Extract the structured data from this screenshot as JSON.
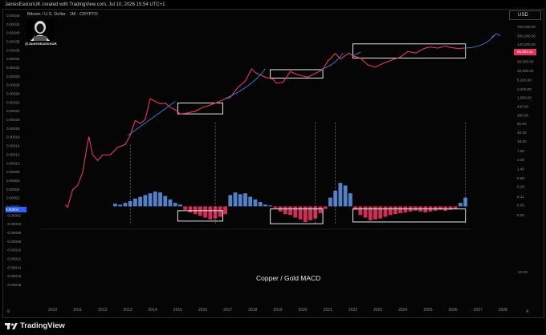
{
  "header": {
    "attribution": "JamesEastonUK created with TradingView.com, Jul 10, 2026 15:54 UTC+1",
    "symbol": "Bitcoin / U.S. Dollar · 1M · CRYPTO",
    "handle": "@JamesEastonUK",
    "currency_button": "USD"
  },
  "chart_data": {
    "type": "line",
    "caption": "Copper / Gold MACD",
    "x_axis": {
      "ticks": [
        "2010",
        "2011",
        "2012",
        "2013",
        "2014",
        "2015",
        "2016",
        "2017",
        "2018",
        "2019",
        "2020",
        "2021",
        "2022",
        "2023",
        "2024",
        "2025",
        "2026",
        "2027",
        "2028"
      ],
      "range": [
        2009.5,
        2028.5
      ]
    },
    "left_axis": {
      "ticks": [
        "0.00044",
        "0.00042",
        "0.00040",
        "0.00038",
        "0.00036",
        "0.00034",
        "0.00032",
        "0.00030",
        "0.00028",
        "0.00026",
        "0.00024",
        "0.00022",
        "0.00020",
        "0.00018",
        "0.00016",
        "0.00014",
        "0.00012",
        "0.00010",
        "0.00008",
        "0.00006",
        "0.00004",
        "0.00002",
        "0.00000",
        "-0.00002",
        "-0.00004",
        "-0.00006",
        "-0.00008",
        "-0.00010",
        "-0.00012",
        "-0.00014",
        "-0.00016",
        "-0.00018"
      ],
      "current_value_label": "0.00004",
      "range": [
        -0.00018,
        0.00044
      ]
    },
    "right_axis": {
      "ticks": [
        "700,000.00",
        "300,000.00",
        "140,000.00",
        "60,000.00",
        "28,000.00",
        "12,000.00",
        "5,200.00",
        "2,200.00",
        "1,000.00",
        "440.00",
        "200.00",
        "90.00",
        "40.00",
        "18.00",
        "7.50",
        "3.30",
        "1.40",
        "0.60",
        "0.28",
        "0.11",
        "0.05",
        "0.02",
        "-10.00"
      ],
      "current_price_label": "95,563.41",
      "scale": "log"
    },
    "series": [
      {
        "name": "Bitcoin / U.S. Dollar",
        "color": "#e8335f",
        "scale": "log",
        "x": [
          2010.5,
          2010.6,
          2010.7,
          2010.8,
          2010.9,
          2011.0,
          2011.2,
          2011.35,
          2011.45,
          2011.6,
          2011.8,
          2012.0,
          2012.3,
          2012.6,
          2012.9,
          2013.1,
          2013.3,
          2013.5,
          2013.7,
          2013.9,
          2014.1,
          2014.3,
          2014.5,
          2014.7,
          2014.9,
          2015.1,
          2015.4,
          2015.7,
          2016.0,
          2016.3,
          2016.6,
          2016.9,
          2017.1,
          2017.4,
          2017.7,
          2017.95,
          2018.1,
          2018.3,
          2018.5,
          2018.8,
          2018.95,
          2019.2,
          2019.5,
          2019.75,
          2020.0,
          2020.2,
          2020.5,
          2020.8,
          2021.0,
          2021.3,
          2021.5,
          2021.85,
          2022.0,
          2022.3,
          2022.6,
          2022.9,
          2023.2,
          2023.5,
          2023.9,
          2024.2,
          2024.5,
          2024.9,
          2025.1,
          2025.4,
          2025.7,
          2025.9,
          2026.2,
          2026.5
        ],
        "values": [
          0.05,
          0.04,
          0.09,
          0.2,
          0.25,
          0.3,
          1.0,
          8,
          27,
          5,
          3,
          5,
          5,
          10,
          13,
          30,
          120,
          90,
          130,
          900,
          700,
          550,
          600,
          400,
          320,
          220,
          240,
          280,
          400,
          500,
          650,
          900,
          1000,
          2500,
          4500,
          14000,
          10000,
          8000,
          6500,
          5500,
          3700,
          4000,
          11000,
          8500,
          7200,
          6500,
          9300,
          13000,
          29000,
          58000,
          35000,
          60000,
          46000,
          38000,
          20000,
          16500,
          23000,
          30000,
          42000,
          70000,
          60000,
          96000,
          105000,
          95000,
          115000,
          100000,
          92000,
          95563
        ]
      },
      {
        "name": "Copper / Gold MACD",
        "type": "histogram",
        "x": [
          2012.5,
          2012.7,
          2012.9,
          2013.1,
          2013.3,
          2013.5,
          2013.7,
          2013.9,
          2014.1,
          2014.3,
          2014.5,
          2014.7,
          2014.9,
          2015.1,
          2015.3,
          2015.5,
          2015.7,
          2015.9,
          2016.1,
          2016.3,
          2016.5,
          2016.7,
          2016.9,
          2017.1,
          2017.3,
          2017.5,
          2017.7,
          2017.9,
          2018.1,
          2018.3,
          2018.5,
          2018.7,
          2018.9,
          2019.1,
          2019.3,
          2019.5,
          2019.7,
          2019.9,
          2020.1,
          2020.3,
          2020.5,
          2020.7,
          2020.9,
          2021.1,
          2021.3,
          2021.5,
          2021.7,
          2021.9,
          2022.1,
          2022.3,
          2022.5,
          2022.7,
          2022.9,
          2023.1,
          2023.3,
          2023.5,
          2023.7,
          2023.9,
          2024.1,
          2024.3,
          2024.5,
          2024.7,
          2024.9,
          2025.1,
          2025.3,
          2025.5,
          2025.7,
          2025.9,
          2026.1,
          2026.3,
          2026.5
        ],
        "values": [
          6e-06,
          4e-06,
          8e-06,
          1.2e-05,
          1.8e-05,
          2.2e-05,
          2.6e-05,
          3e-05,
          3.4e-05,
          3.2e-05,
          2.4e-05,
          1.6e-05,
          8e-06,
          4e-06,
          -8e-06,
          -1.4e-05,
          -1.8e-05,
          -2.2e-05,
          -2.6e-05,
          -3e-05,
          -2.8e-05,
          -2.4e-05,
          -1.8e-05,
          2.6e-05,
          3.2e-05,
          2.8e-05,
          3e-05,
          2.2e-05,
          1.6e-05,
          1e-05,
          4e-06,
          2e-06,
          -4e-06,
          -1.2e-05,
          -1.8e-05,
          -2e-05,
          -2.6e-05,
          -3e-05,
          -3.6e-05,
          -3.2e-05,
          -2.8e-05,
          -1.6e-05,
          -6e-06,
          2e-05,
          3.6e-05,
          5.4e-05,
          4.8e-05,
          3e-05,
          -8e-06,
          -2e-05,
          -2.6e-05,
          -3.2e-05,
          -3e-05,
          -2.8e-05,
          -2.4e-05,
          -2e-05,
          -1.8e-05,
          -1.6e-05,
          -1.4e-05,
          -1.2e-05,
          -1e-05,
          -1.2e-05,
          -1.4e-05,
          -1.2e-05,
          -1e-05,
          -8e-06,
          -1e-05,
          -8e-06,
          -6e-06,
          8e-06,
          2e-05
        ]
      }
    ],
    "colors": {
      "price_line": "#e8335f",
      "macd_positive": "#5b8fe0",
      "macd_negative": "#e8335f",
      "arrow": "#3f7fe0",
      "highlight_box": "#e6e6e6"
    },
    "grid": false
  },
  "footer": {
    "brand": "TradingView"
  }
}
